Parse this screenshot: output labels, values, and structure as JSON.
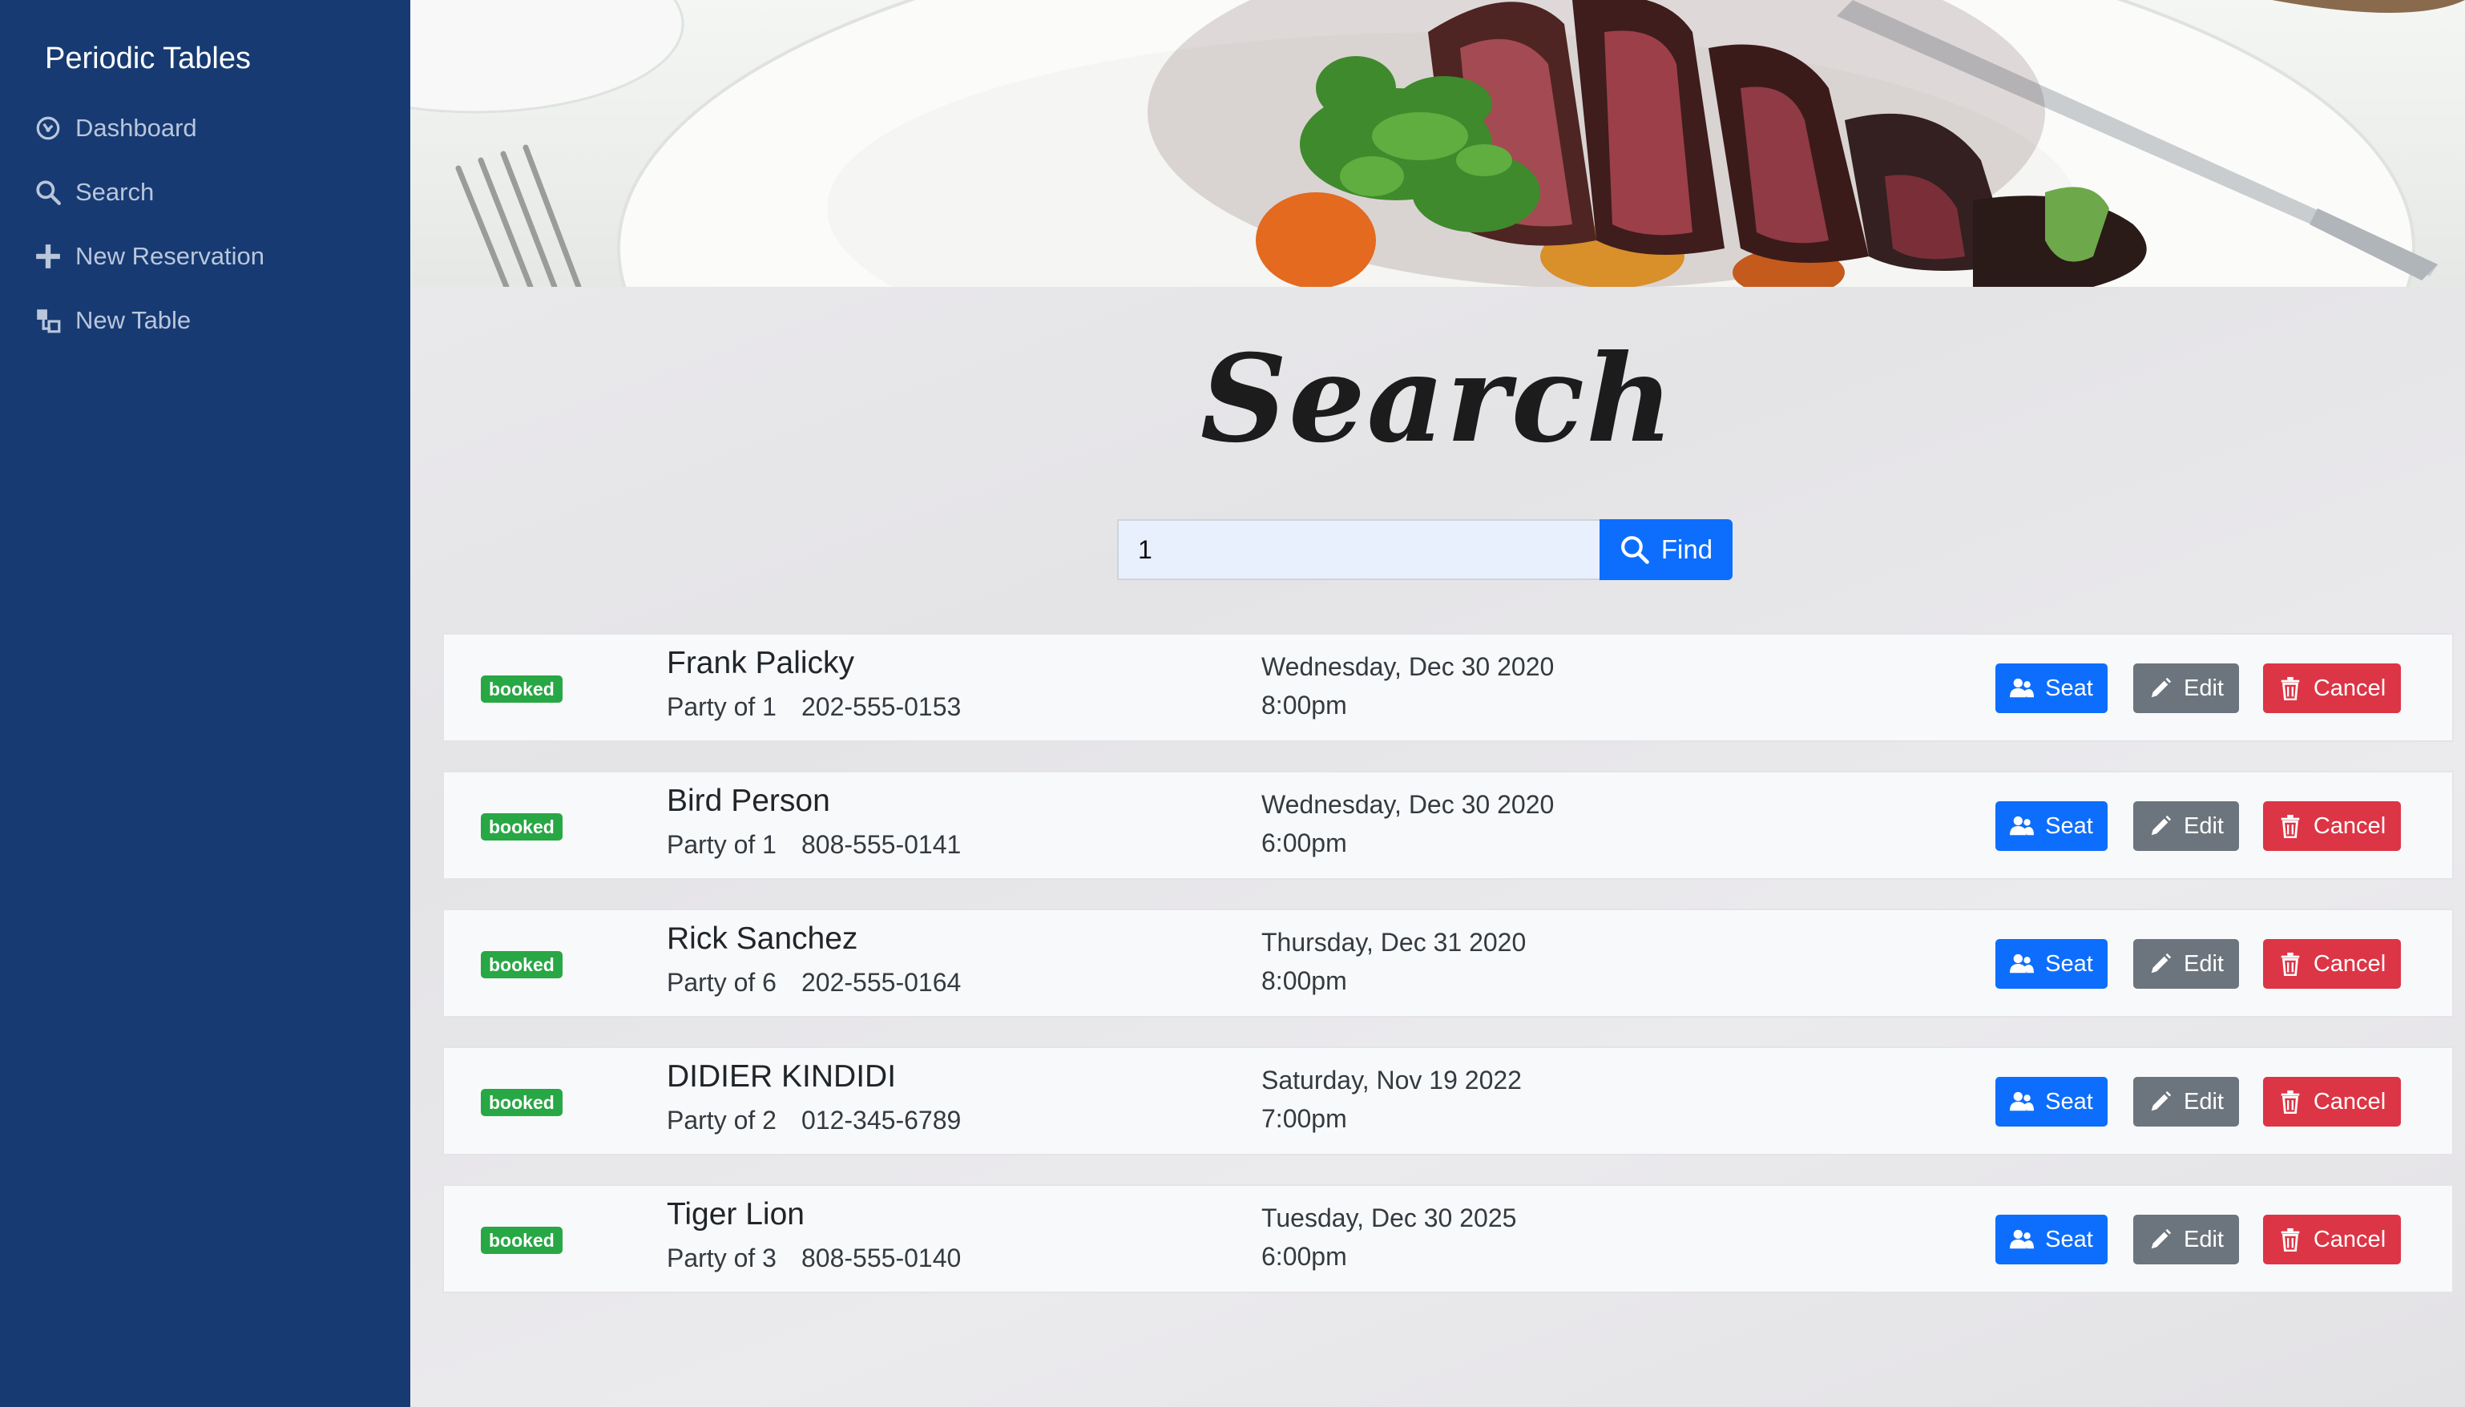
{
  "app": {
    "brand": "Periodic Tables"
  },
  "sidebar": {
    "items": [
      {
        "label": "Dashboard",
        "icon": "dashboard-icon"
      },
      {
        "label": "Search",
        "icon": "search-icon"
      },
      {
        "label": "New Reservation",
        "icon": "plus-icon"
      },
      {
        "label": "New Table",
        "icon": "table-icon"
      }
    ]
  },
  "page": {
    "title": "Search"
  },
  "search": {
    "value": "1",
    "placeholder": "",
    "button_label": "Find"
  },
  "actions": {
    "seat_label": "Seat",
    "edit_label": "Edit",
    "cancel_label": "Cancel"
  },
  "reservations": [
    {
      "status": "booked",
      "name": "Frank Palicky",
      "party": "Party of 1",
      "phone": "202-555-0153",
      "date": "Wednesday, Dec 30 2020",
      "time": "8:00pm"
    },
    {
      "status": "booked",
      "name": "Bird Person",
      "party": "Party of 1",
      "phone": "808-555-0141",
      "date": "Wednesday, Dec 30 2020",
      "time": "6:00pm"
    },
    {
      "status": "booked",
      "name": "Rick Sanchez",
      "party": "Party of 6",
      "phone": "202-555-0164",
      "date": "Thursday, Dec 31 2020",
      "time": "8:00pm"
    },
    {
      "status": "booked",
      "name": "DIDIER KINDIDI",
      "party": "Party of 2",
      "phone": "012-345-6789",
      "date": "Saturday, Nov 19 2022",
      "time": "7:00pm"
    },
    {
      "status": "booked",
      "name": "Tiger Lion",
      "party": "Party of 3",
      "phone": "808-555-0140",
      "date": "Tuesday, Dec 30 2025",
      "time": "6:00pm"
    }
  ],
  "colors": {
    "sidebar_bg": "#173a72",
    "primary": "#0d6efd",
    "secondary": "#6c757d",
    "danger": "#dc3545",
    "success": "#28a745"
  }
}
